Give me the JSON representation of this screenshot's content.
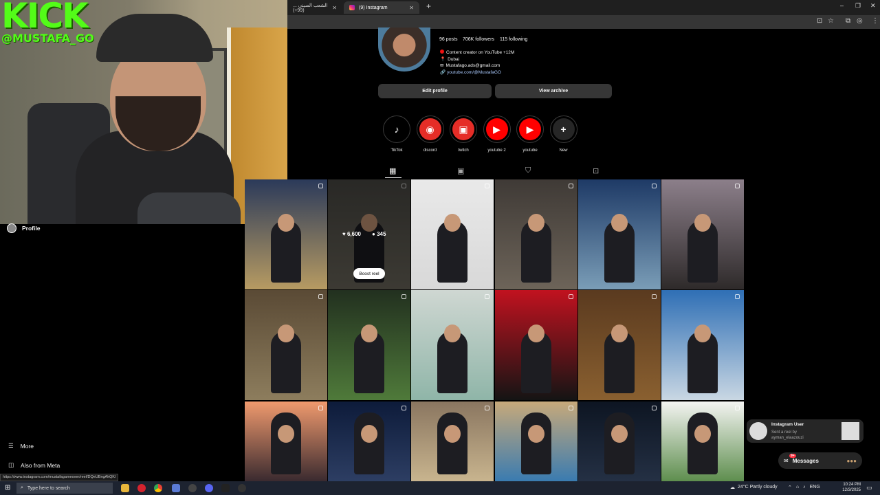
{
  "overlay": {
    "brand": "KICK",
    "handle": "@MUSTAFA_GO"
  },
  "browser": {
    "tabs": [
      {
        "label": "الشعب الصيني ... (99+)"
      },
      {
        "label": "(9) Instagram"
      }
    ],
    "new_tab": "+",
    "window_controls": [
      "–",
      "❐",
      "✕"
    ],
    "status_url": "https://www.instagram.com/mustafagameover/reel/DQeUBngAkQK/"
  },
  "profile": {
    "stats": {
      "posts": "96 posts",
      "followers": "706K followers",
      "following": "115 following"
    },
    "bio": [
      "Content creator on YouTube +12M",
      "Dubai",
      "Mustafago.ads@gmail.com"
    ],
    "link": "youtube.com/@MustafaGO",
    "edit_button": "Edit profile",
    "archive_button": "View archive"
  },
  "highlights": [
    {
      "label": "TikTok",
      "icon": "tiktok-icon",
      "glyph": "♪",
      "color": "#000000"
    },
    {
      "label": "discord",
      "icon": "discord-icon",
      "glyph": "◉",
      "color": "#e52d27"
    },
    {
      "label": "twitch",
      "icon": "twitch-icon",
      "glyph": "▣",
      "color": "#e52d27"
    },
    {
      "label": "youtube 2",
      "icon": "youtube-icon",
      "glyph": "▶",
      "color": "#ff0000"
    },
    {
      "label": "youtube",
      "icon": "youtube-icon",
      "glyph": "▶",
      "color": "#ff0000"
    },
    {
      "label": "New",
      "icon": "plus-icon",
      "glyph": "+",
      "color": "#262626"
    }
  ],
  "profile_tabs": [
    "posts-grid-icon",
    "reels-icon",
    "saved-icon",
    "tagged-icon"
  ],
  "grid_hover": {
    "likes": "6,600",
    "comments": "345",
    "boost": "Boost reel"
  },
  "sidebar": {
    "profile": "Profile",
    "more": "More",
    "meta": "Also from Meta"
  },
  "notification": {
    "title": "Instagram User",
    "line1": "Sent a reel by",
    "line2": "ayman_elaazouzi"
  },
  "messages": {
    "label": "Messages",
    "badge": "9+"
  },
  "taskbar": {
    "search": "Type here to search",
    "weather": "24°C  Partly cloudy",
    "lang": "ENG",
    "time": "10:24 PM",
    "date": "12/3/2025"
  },
  "colors": {
    "accent": "#0095f6",
    "kick": "#53fc18",
    "link": "#a8c7fa"
  }
}
